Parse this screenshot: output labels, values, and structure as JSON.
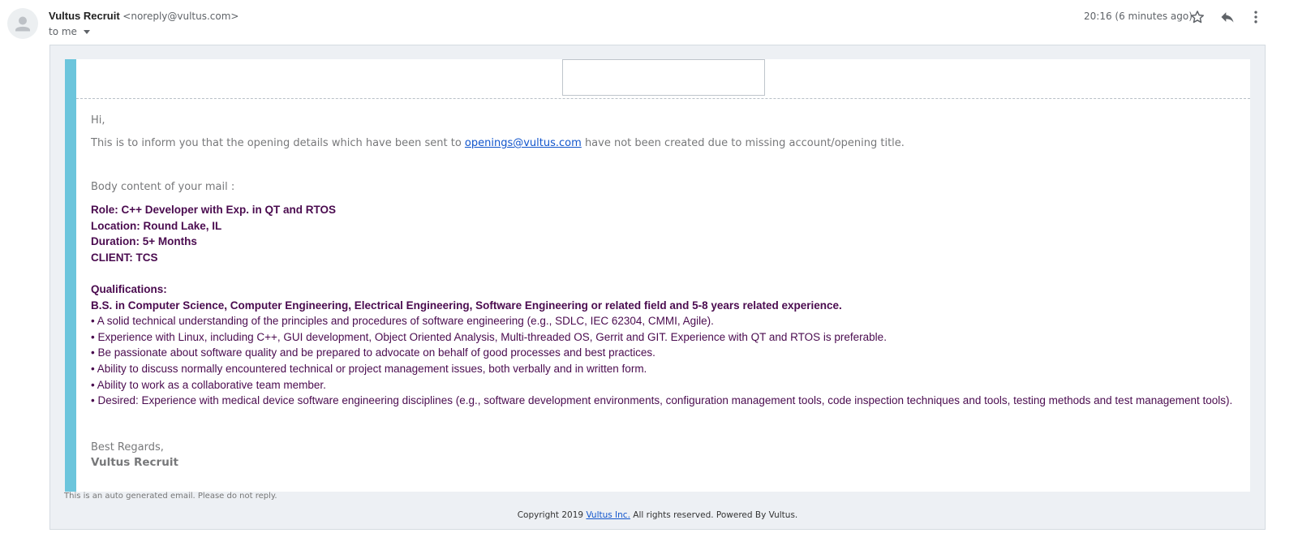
{
  "header": {
    "sender_name": "Vultus Recruit",
    "sender_email": "<noreply@vultus.com>",
    "recipient": "to me",
    "time": "20:16 (6 minutes ago)"
  },
  "icons": [
    "person-icon",
    "star-icon",
    "reply-icon",
    "more-vert-icon",
    "chevron-down-icon"
  ],
  "colors": {
    "accent": "#6cc5dc",
    "job_text": "#4a0b4f",
    "link": "#1155cc",
    "frame_bg": "#edf0f4"
  },
  "email": {
    "greeting": "Hi,",
    "info_prefix": "This is to inform you that the opening details which have been sent to",
    "info_link": "openings@vultus.com",
    "info_suffix": "have not been created due to missing account/opening title.",
    "body_label": "Body content of your mail :",
    "job": {
      "role": "Role: C++ Developer with Exp. in QT and RTOS",
      "location": "Location: Round Lake, IL",
      "duration": "Duration: 5+ Months",
      "client": "CLIENT: TCS",
      "qualifications_heading": "Qualifications:",
      "degree": "B.S. in Computer Science, Computer Engineering, Electrical Engineering, Software Engineering or related field and 5-8 years related experience.",
      "bullets": [
        "• A solid technical understanding of the principles and procedures of software engineering (e.g., SDLC, IEC 62304, CMMI, Agile).",
        "• Experience with Linux, including C++, GUI development, Object Oriented Analysis, Multi-threaded OS, Gerrit and GIT. Experience with QT and RTOS is preferable.",
        "• Be passionate about software quality and be prepared to advocate on behalf of good processes and best practices.",
        "• Ability to discuss normally encountered technical or project management issues, both verbally and in written form.",
        "• Ability to work as a collaborative team member.",
        "• Desired: Experience with medical device software engineering disciplines (e.g., software development environments, configuration management tools, code inspection techniques and tools, testing methods and test management tools)."
      ]
    },
    "regards": "Best Regards,",
    "signature": "Vultus Recruit"
  },
  "footer": {
    "auto_note": "This is an auto generated email. Please do not reply.",
    "copyright_prefix": "Copyright 2019",
    "company_link": "Vultus Inc.",
    "copyright_suffix": "All rights reserved. Powered By Vultus."
  }
}
